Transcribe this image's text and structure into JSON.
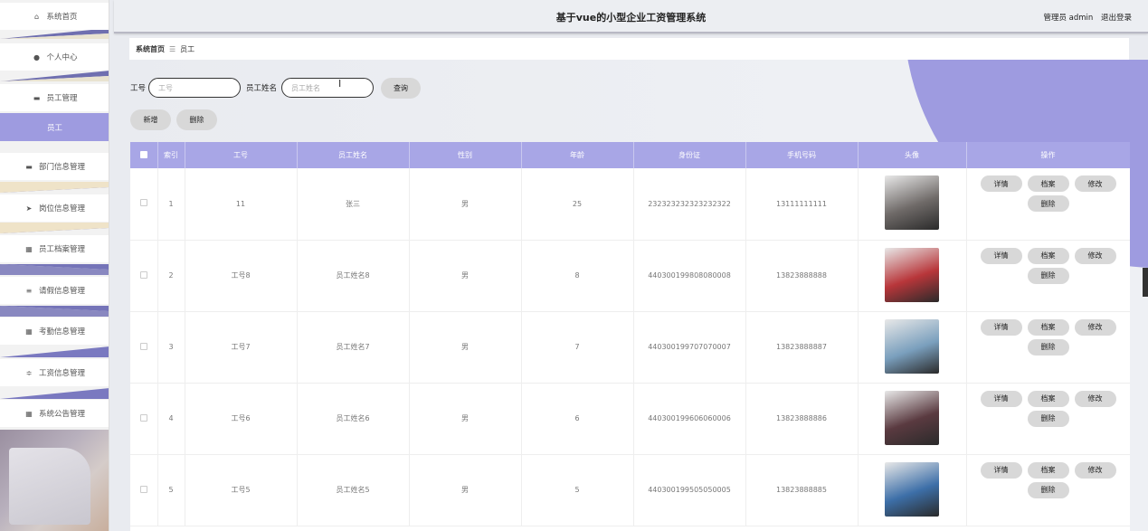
{
  "sidebar": {
    "items": [
      {
        "label": "系统首页",
        "icon": "home-icon",
        "glyph": "⌂"
      },
      {
        "label": "个人中心",
        "icon": "user-icon",
        "glyph": "●"
      },
      {
        "label": "员工管理",
        "icon": "chat-icon",
        "glyph": "▬"
      },
      {
        "label": "员工",
        "icon": "",
        "glyph": ""
      },
      {
        "label": "部门信息管理",
        "icon": "chat-icon",
        "glyph": "▬"
      },
      {
        "label": "岗位信息管理",
        "icon": "send-icon",
        "glyph": "➤"
      },
      {
        "label": "员工档案管理",
        "icon": "grid-icon",
        "glyph": "▦"
      },
      {
        "label": "请假信息管理",
        "icon": "list-icon",
        "glyph": "≡"
      },
      {
        "label": "考勤信息管理",
        "icon": "grid-icon",
        "glyph": "▦"
      },
      {
        "label": "工资信息管理",
        "icon": "sliders-icon",
        "glyph": "≑"
      },
      {
        "label": "系统公告管理",
        "icon": "grid-icon",
        "glyph": "▦"
      }
    ]
  },
  "header": {
    "title": "基于vue的小型企业工资管理系统",
    "role": "管理员 admin",
    "logout": "退出登录"
  },
  "breadcrumb": {
    "home": "系统首页",
    "sep": "☰",
    "current": "员工"
  },
  "search": {
    "id_label": "工号",
    "id_placeholder": "工号",
    "name_label": "员工姓名",
    "name_placeholder": "员工姓名",
    "query_button": "查询"
  },
  "actions": {
    "add": "新增",
    "delete": "删除"
  },
  "table": {
    "headers": [
      "索引",
      "工号",
      "员工姓名",
      "性别",
      "年龄",
      "身份证",
      "手机号码",
      "头像",
      "操作"
    ],
    "ops": [
      "详情",
      "档案",
      "修改",
      "删除"
    ],
    "rows": [
      {
        "index": "1",
        "id": "11",
        "name": "张三",
        "gender": "男",
        "age": "25",
        "idcard": "232323232323232322",
        "phone": "13111111111",
        "avatar_color": "#6f6a68"
      },
      {
        "index": "2",
        "id": "工号8",
        "name": "员工姓名8",
        "gender": "男",
        "age": "8",
        "idcard": "440300199808080008",
        "phone": "13823888888",
        "avatar_color": "#b8363a"
      },
      {
        "index": "3",
        "id": "工号7",
        "name": "员工姓名7",
        "gender": "男",
        "age": "7",
        "idcard": "440300199707070007",
        "phone": "13823888887",
        "avatar_color": "#7a9fbd"
      },
      {
        "index": "4",
        "id": "工号6",
        "name": "员工姓名6",
        "gender": "男",
        "age": "6",
        "idcard": "440300199606060006",
        "phone": "13823888886",
        "avatar_color": "#5a3a40"
      },
      {
        "index": "5",
        "id": "工号5",
        "name": "员工姓名5",
        "gender": "男",
        "age": "5",
        "idcard": "440300199505050005",
        "phone": "13823888885",
        "avatar_color": "#3d6fa8"
      }
    ]
  }
}
